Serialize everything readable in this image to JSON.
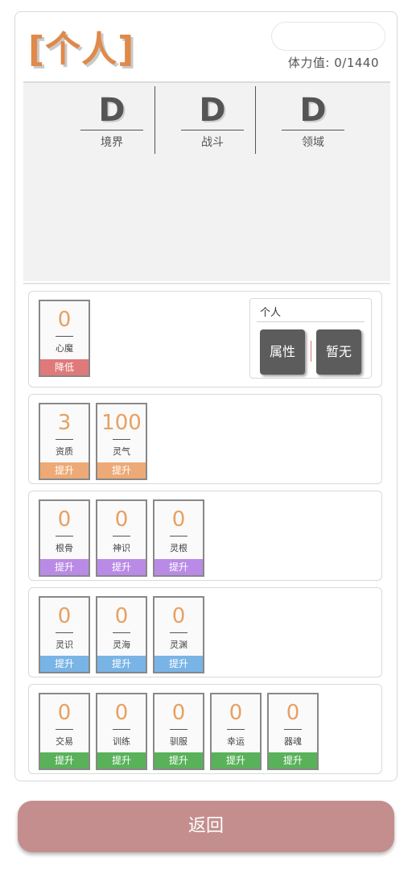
{
  "header": {
    "title_open": "[",
    "title": "个人",
    "title_close": "]",
    "stamina_label": "体力值: 0/1440"
  },
  "grades": [
    {
      "letter": "D",
      "label": "境界"
    },
    {
      "letter": "D",
      "label": "战斗"
    },
    {
      "letter": "D",
      "label": "领域"
    }
  ],
  "section1": {
    "cards": [
      {
        "value": "0",
        "label": "心魔",
        "button": "降低"
      }
    ],
    "personal": {
      "title": "个人",
      "attr_button": "属性",
      "none_button": "暂无"
    }
  },
  "section2": {
    "cards": [
      {
        "value": "3",
        "label": "资质",
        "button": "提升"
      },
      {
        "value": "100",
        "label": "灵气",
        "button": "提升"
      }
    ]
  },
  "section3": {
    "cards": [
      {
        "value": "0",
        "label": "根骨",
        "button": "提升"
      },
      {
        "value": "0",
        "label": "神识",
        "button": "提升"
      },
      {
        "value": "0",
        "label": "灵根",
        "button": "提升"
      }
    ]
  },
  "section4": {
    "cards": [
      {
        "value": "0",
        "label": "灵识",
        "button": "提升"
      },
      {
        "value": "0",
        "label": "灵海",
        "button": "提升"
      },
      {
        "value": "0",
        "label": "灵渊",
        "button": "提升"
      }
    ]
  },
  "section5": {
    "cards": [
      {
        "value": "0",
        "label": "交易",
        "button": "提升"
      },
      {
        "value": "0",
        "label": "训练",
        "button": "提升"
      },
      {
        "value": "0",
        "label": "驯服",
        "button": "提升"
      },
      {
        "value": "0",
        "label": "幸运",
        "button": "提升"
      },
      {
        "value": "0",
        "label": "器魂",
        "button": "提升"
      }
    ]
  },
  "footer": {
    "return_label": "返回"
  },
  "colors": {
    "title": "#e0894a",
    "decrease": "#e0797a",
    "orange": "#edaa76",
    "purple": "#b98be6",
    "blue": "#79b4e6",
    "green": "#59b25a",
    "return": "#c48e8e"
  }
}
